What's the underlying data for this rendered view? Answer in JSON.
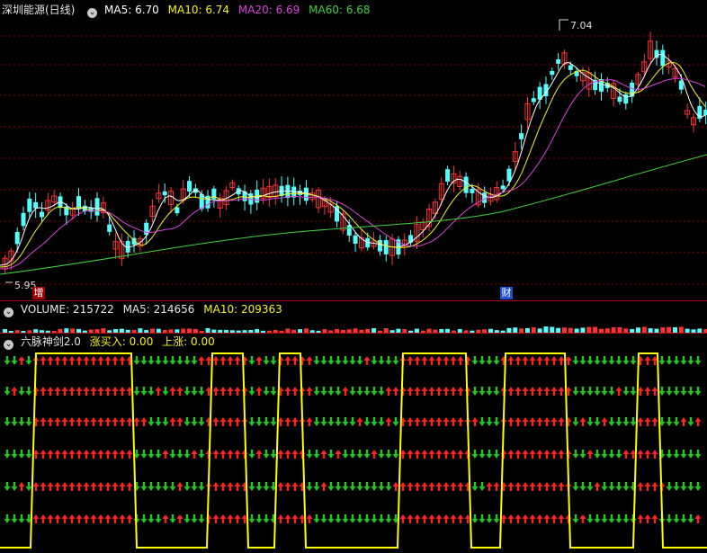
{
  "main_panel": {
    "stock_name": "深圳能源(日线)",
    "ma_labels": [
      {
        "text": "MA5: 6.70",
        "color": "#ffffff"
      },
      {
        "text": "MA10: 6.74",
        "color": "#f4f41c"
      },
      {
        "text": "MA20: 6.69",
        "color": "#e040e0"
      },
      {
        "text": "MA60: 6.68",
        "color": "#3fd23f"
      }
    ],
    "high_label": "7.04",
    "low_label": "5.95",
    "markers": [
      {
        "text": "增"
      },
      {
        "text": "财"
      }
    ]
  },
  "volume_panel": {
    "title": "VOLUME: 215722",
    "ma5": "MA5: 214656",
    "ma10": "MA10: 209363"
  },
  "indicator_panel": {
    "title": "六脉神剑2.0",
    "buy_label": "涨买入: 0.00",
    "up_label": "上涨: 0.00"
  },
  "colors": {
    "up": "#ff3232",
    "down": "#54ffff",
    "arrow_up": "#ff2020",
    "arrow_down": "#1ec81e",
    "signal": "#ffff00",
    "grid": "#8b0000"
  },
  "chart_data": {
    "type": "candlestick",
    "price_range": [
      5.95,
      7.04
    ],
    "series": [
      {
        "name": "MA5",
        "values": [
          6.7
        ]
      },
      {
        "name": "MA10",
        "values": [
          6.74
        ]
      },
      {
        "name": "MA20",
        "values": [
          6.69
        ]
      },
      {
        "name": "MA60",
        "values": [
          6.68
        ]
      }
    ],
    "volume": {
      "last": 215722,
      "ma5": 214656,
      "ma10": 209363
    }
  }
}
